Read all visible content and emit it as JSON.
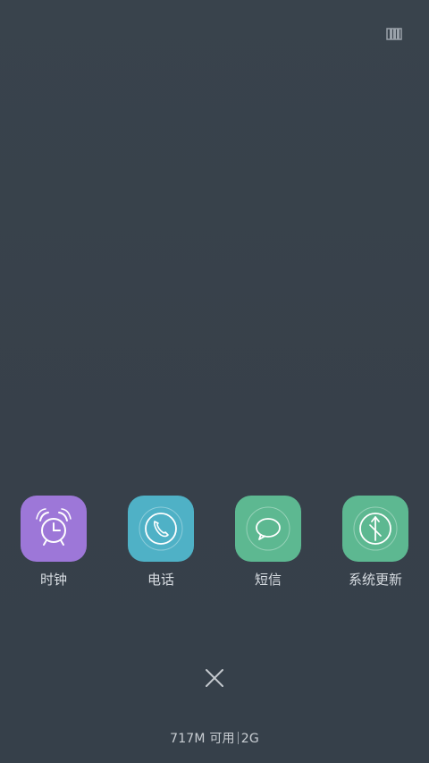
{
  "background_color": "#38414a",
  "topbar": {
    "icon": "recent-layout-icon"
  },
  "apps": [
    {
      "label": "时钟",
      "icon": "alarm-clock-icon",
      "color": "#9d77d8"
    },
    {
      "label": "电话",
      "icon": "phone-icon",
      "color": "#4fb1c6"
    },
    {
      "label": "短信",
      "icon": "message-icon",
      "color": "#5db891"
    },
    {
      "label": "系统更新",
      "icon": "system-update-icon",
      "color": "#5db891"
    }
  ],
  "close": {
    "icon": "close-icon"
  },
  "memory": {
    "available": "717M 可用",
    "total": "2G"
  }
}
